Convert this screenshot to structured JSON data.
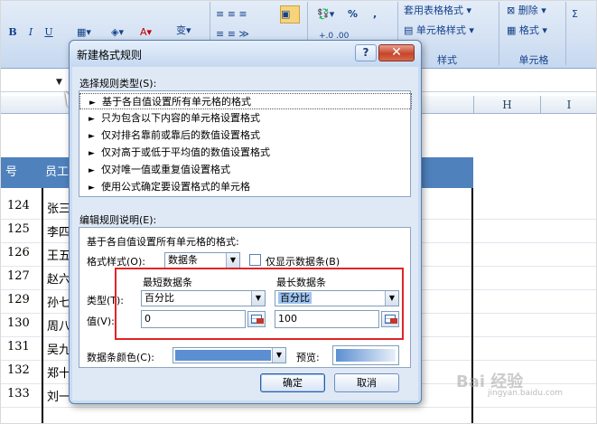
{
  "ribbon": {
    "font_buttons": [
      "B",
      "I",
      "U"
    ],
    "groups": [
      {
        "label": "样式",
        "items": [
          "套用表格格式",
          "单元格样式"
        ]
      },
      {
        "label": "单元格",
        "items": [
          "删除",
          "格式"
        ]
      }
    ],
    "percent": "%",
    "comma": ",",
    "decimal_inc": "+.0 .00"
  },
  "columns": [
    "H",
    "I"
  ],
  "table": {
    "header": [
      "号",
      "员工"
    ],
    "rows": [
      {
        "id": "124",
        "name": "张三"
      },
      {
        "id": "125",
        "name": "李四"
      },
      {
        "id": "126",
        "name": "王五"
      },
      {
        "id": "127",
        "name": "赵六"
      },
      {
        "id": "129",
        "name": "孙七"
      },
      {
        "id": "130",
        "name": "周八"
      },
      {
        "id": "131",
        "name": "吴九"
      },
      {
        "id": "132",
        "name": "郑十"
      },
      {
        "id": "133",
        "name": "刘一"
      }
    ]
  },
  "dialog": {
    "title": "新建格式规则",
    "help": "?",
    "close": "✕",
    "select_type_label": "选择规则类型(S):",
    "rule_types": [
      "基于各自值设置所有单元格的格式",
      "只为包含以下内容的单元格设置格式",
      "仅对排名靠前或靠后的数值设置格式",
      "仅对高于或低于平均值的数值设置格式",
      "仅对唯一值或重复值设置格式",
      "使用公式确定要设置格式的单元格"
    ],
    "edit_label": "编辑规则说明(E):",
    "edit_desc": "基于各自值设置所有单元格的格式:",
    "format_style_label": "格式样式(O):",
    "format_style_value": "数据条",
    "show_bar_only": "仅显示数据条(B)",
    "min_header": "最短数据条",
    "max_header": "最长数据条",
    "type_label": "类型(T):",
    "value_label": "值(V):",
    "min_type": "百分比",
    "max_type": "百分比",
    "min_value": "0",
    "max_value": "100",
    "bar_color_label": "数据条颜色(C):",
    "preview_label": "预览:",
    "ok": "确定",
    "cancel": "取消",
    "bar_color": "#5b8fd1"
  },
  "watermark": {
    "text": "Bai 经验",
    "sub": "jingyan.baidu.com"
  }
}
